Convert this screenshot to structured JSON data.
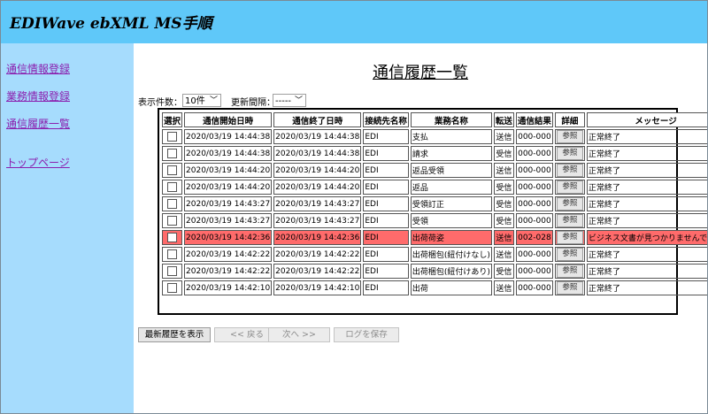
{
  "app": {
    "title": "EDIWave ebXML MS手順"
  },
  "sidebar": {
    "items": [
      {
        "label": "通信情報登録"
      },
      {
        "label": "業務情報登録"
      },
      {
        "label": "通信履歴一覧"
      },
      {
        "label": "トップページ"
      }
    ]
  },
  "page": {
    "title": "通信履歴一覧"
  },
  "controls": {
    "count_label": "表示件数：",
    "count_value": "10件",
    "interval_label": "更新間隔：",
    "interval_value": "-----"
  },
  "table": {
    "headers": [
      "選択",
      "通信開始日時",
      "通信終了日時",
      "接続先名称",
      "業務名称",
      "転送",
      "通信結果",
      "詳細",
      "メッセージ"
    ],
    "detail_label": "参照",
    "rows": [
      {
        "start": "2020/03/19 14:44:38",
        "end": "2020/03/19 14:44:38",
        "partner": "EDI",
        "business": "支払",
        "direction": "送信",
        "result": "000-000",
        "message": "正常終了",
        "error": false
      },
      {
        "start": "2020/03/19 14:44:38",
        "end": "2020/03/19 14:44:38",
        "partner": "EDI",
        "business": "請求",
        "direction": "受信",
        "result": "000-000",
        "message": "正常終了",
        "error": false
      },
      {
        "start": "2020/03/19 14:44:20",
        "end": "2020/03/19 14:44:20",
        "partner": "EDI",
        "business": "返品受領",
        "direction": "送信",
        "result": "000-000",
        "message": "正常終了",
        "error": false
      },
      {
        "start": "2020/03/19 14:44:20",
        "end": "2020/03/19 14:44:20",
        "partner": "EDI",
        "business": "返品",
        "direction": "受信",
        "result": "000-000",
        "message": "正常終了",
        "error": false
      },
      {
        "start": "2020/03/19 14:43:27",
        "end": "2020/03/19 14:43:27",
        "partner": "EDI",
        "business": "受領訂正",
        "direction": "受信",
        "result": "000-000",
        "message": "正常終了",
        "error": false
      },
      {
        "start": "2020/03/19 14:43:27",
        "end": "2020/03/19 14:43:27",
        "partner": "EDI",
        "business": "受領",
        "direction": "受信",
        "result": "000-000",
        "message": "正常終了",
        "error": false
      },
      {
        "start": "2020/03/19 14:42:36",
        "end": "2020/03/19 14:42:36",
        "partner": "EDI",
        "business": "出荷荷姿",
        "direction": "送信",
        "result": "002-028",
        "message": "ビジネス文書が見つかりませんでした",
        "error": true
      },
      {
        "start": "2020/03/19 14:42:22",
        "end": "2020/03/19 14:42:22",
        "partner": "EDI",
        "business": "出荷梱包(紐付けなし)",
        "direction": "送信",
        "result": "000-000",
        "message": "正常終了",
        "error": false
      },
      {
        "start": "2020/03/19 14:42:22",
        "end": "2020/03/19 14:42:22",
        "partner": "EDI",
        "business": "出荷梱包(紐付けあり)",
        "direction": "受信",
        "result": "000-000",
        "message": "正常終了",
        "error": false
      },
      {
        "start": "2020/03/19 14:42:10",
        "end": "2020/03/19 14:42:10",
        "partner": "EDI",
        "business": "出荷",
        "direction": "送信",
        "result": "000-000",
        "message": "正常終了",
        "error": false
      }
    ]
  },
  "buttons": {
    "refresh": "最新履歴を表示",
    "back": "<< 戻る",
    "next": "次へ >>",
    "save_log": "ログを保存"
  },
  "colors": {
    "header_bg": "#5fc8f9",
    "sidebar_bg": "#a6dcfd",
    "link": "#8b1fae",
    "error_row": "#ff6b6b"
  }
}
